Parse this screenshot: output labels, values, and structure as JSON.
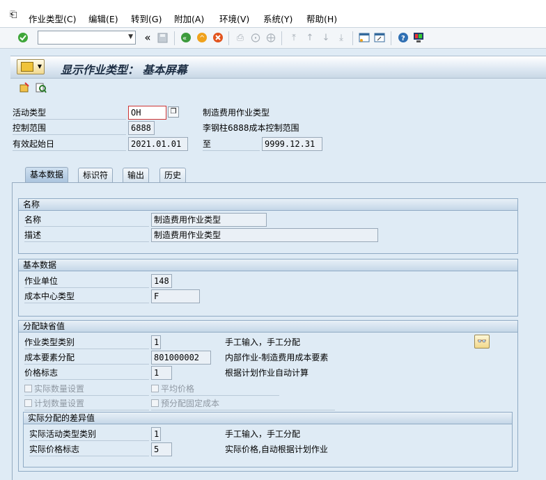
{
  "menu": {
    "items": [
      "作业类型(C)",
      "编辑(E)",
      "转到(G)",
      "附加(A)",
      "环境(V)",
      "系统(Y)",
      "帮助(H)"
    ]
  },
  "toolbar": {
    "command_value": "",
    "nav_arrows": "«",
    "icons": [
      "check-icon",
      "command-field",
      "save-icon",
      "back-icon",
      "exit-icon",
      "cancel-icon",
      "print-icon",
      "find-icon",
      "find-next-icon",
      "first-page-icon",
      "previous-page-icon",
      "next-page-icon",
      "last-page-icon",
      "create-session-icon",
      "shortcut-icon",
      "help-icon",
      "customize-layout-icon"
    ]
  },
  "title": {
    "text": "显示作业类型：  基本屏幕"
  },
  "header": {
    "activity_type_label": "活动类型",
    "activity_type_value": "OH",
    "activity_type_desc": "制造费用作业类型",
    "controlling_area_label": "控制范围",
    "controlling_area_value": "6888",
    "controlling_area_desc": "李钢柱6888成本控制范围",
    "valid_from_label": "有效起始日",
    "valid_from_value": "2021.01.01",
    "valid_to_label": "至",
    "valid_to_value": "9999.12.31"
  },
  "tabs": [
    "基本数据",
    "标识符",
    "输出",
    "历史"
  ],
  "groups": {
    "names": {
      "title": "名称",
      "name_label": "名称",
      "name_value": "制造费用作业类型",
      "desc_label": "描述",
      "desc_value": "制造费用作业类型"
    },
    "basic": {
      "title": "基本数据",
      "unit_label": "作业单位",
      "unit_value": "148",
      "cc_category_label": "成本中心类型",
      "cc_category_value": "F"
    },
    "defaults": {
      "title": "分配缺省值",
      "at_category_label": "作业类型类别",
      "at_category_value": "1",
      "at_category_desc": "手工输入，手工分配",
      "cost_element_label": "成本要素分配",
      "cost_element_value": "801000002",
      "cost_element_desc": "内部作业-制造费用成本要素",
      "price_indicator_label": "价格标志",
      "price_indicator_value": "1",
      "price_indicator_desc": "根据计划作业自动计算",
      "chk_actual_qty": "实际数量设置",
      "chk_avg_price": "平均价格",
      "chk_plan_qty": "计划数量设置",
      "chk_fixed_cost": "预分配固定成本"
    },
    "variance": {
      "title": "实际分配的差异值",
      "actual_at_cat_label": "实际活动类型类别",
      "actual_at_cat_value": "1",
      "actual_at_cat_desc": "手工输入，手工分配",
      "actual_price_label": "实际价格标志",
      "actual_price_value": "5",
      "actual_price_desc": "实际价格,自动根据计划作业"
    }
  }
}
